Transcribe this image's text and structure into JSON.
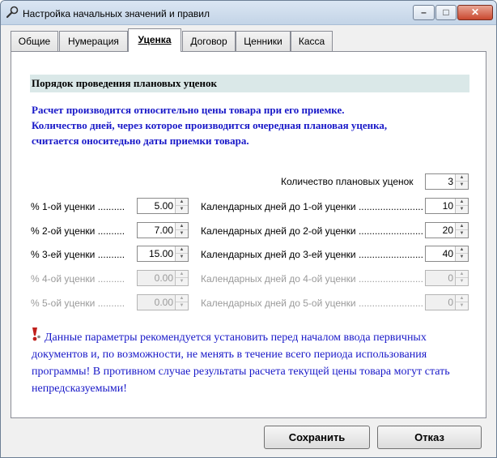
{
  "window": {
    "title": "Настройка начальных значений и правил",
    "icon": "wrench-icon",
    "controls": {
      "minimize": "–",
      "maximize": "□",
      "close": "✕"
    }
  },
  "tabs": [
    {
      "label": "Общие",
      "active": false
    },
    {
      "label": "Нумерация",
      "active": false
    },
    {
      "label": "Уценка",
      "active": true
    },
    {
      "label": "Договор",
      "active": false
    },
    {
      "label": "Ценники",
      "active": false
    },
    {
      "label": "Касса",
      "active": false
    }
  ],
  "section": {
    "heading": "Порядок проведения плановых уценок",
    "info_lines": [
      "Расчет производится относительно цены товара при его приемке.",
      "Количество дней, через которое производится очередная плановая уценка,",
      "считается оноситедьно даты приемки товара."
    ]
  },
  "count": {
    "label": "Количество плановых уценок",
    "value": "3"
  },
  "rows": [
    {
      "pct_label": "% 1-ой уценки",
      "pct_value": "5.00",
      "days_label": "Календарных дней до 1-ой уценки",
      "days_value": "10",
      "enabled": true
    },
    {
      "pct_label": "% 2-ой уценки",
      "pct_value": "7.00",
      "days_label": "Календарных дней до 2-ой уценки",
      "days_value": "20",
      "enabled": true
    },
    {
      "pct_label": "% 3-ей уценки",
      "pct_value": "15.00",
      "days_label": "Календарных дней до 3-ей уценки",
      "days_value": "40",
      "enabled": true
    },
    {
      "pct_label": "% 4-ой уценки",
      "pct_value": "0.00",
      "days_label": "Календарных дней до 4-ой уценки",
      "days_value": "0",
      "enabled": false
    },
    {
      "pct_label": "% 5-ой уценки",
      "pct_value": "0.00",
      "days_label": "Календарных дней до 5-ой уценки",
      "days_value": "0",
      "enabled": false
    }
  ],
  "warning": {
    "icon": "exclamation-icon",
    "text": "Данные параметры рекомендуется установить перед началом ввода первичных документов и, по возможности, не менять в течение всего периода использования программы! В противном случае результаты расчета текущей цены товара могут стать непредсказуемыми!"
  },
  "buttons": {
    "save": "Сохранить",
    "cancel": "Отказ"
  },
  "colors": {
    "accent_text": "#1818c8",
    "heading_bg": "#dae8e8",
    "warning_icon": "#c0201c"
  }
}
